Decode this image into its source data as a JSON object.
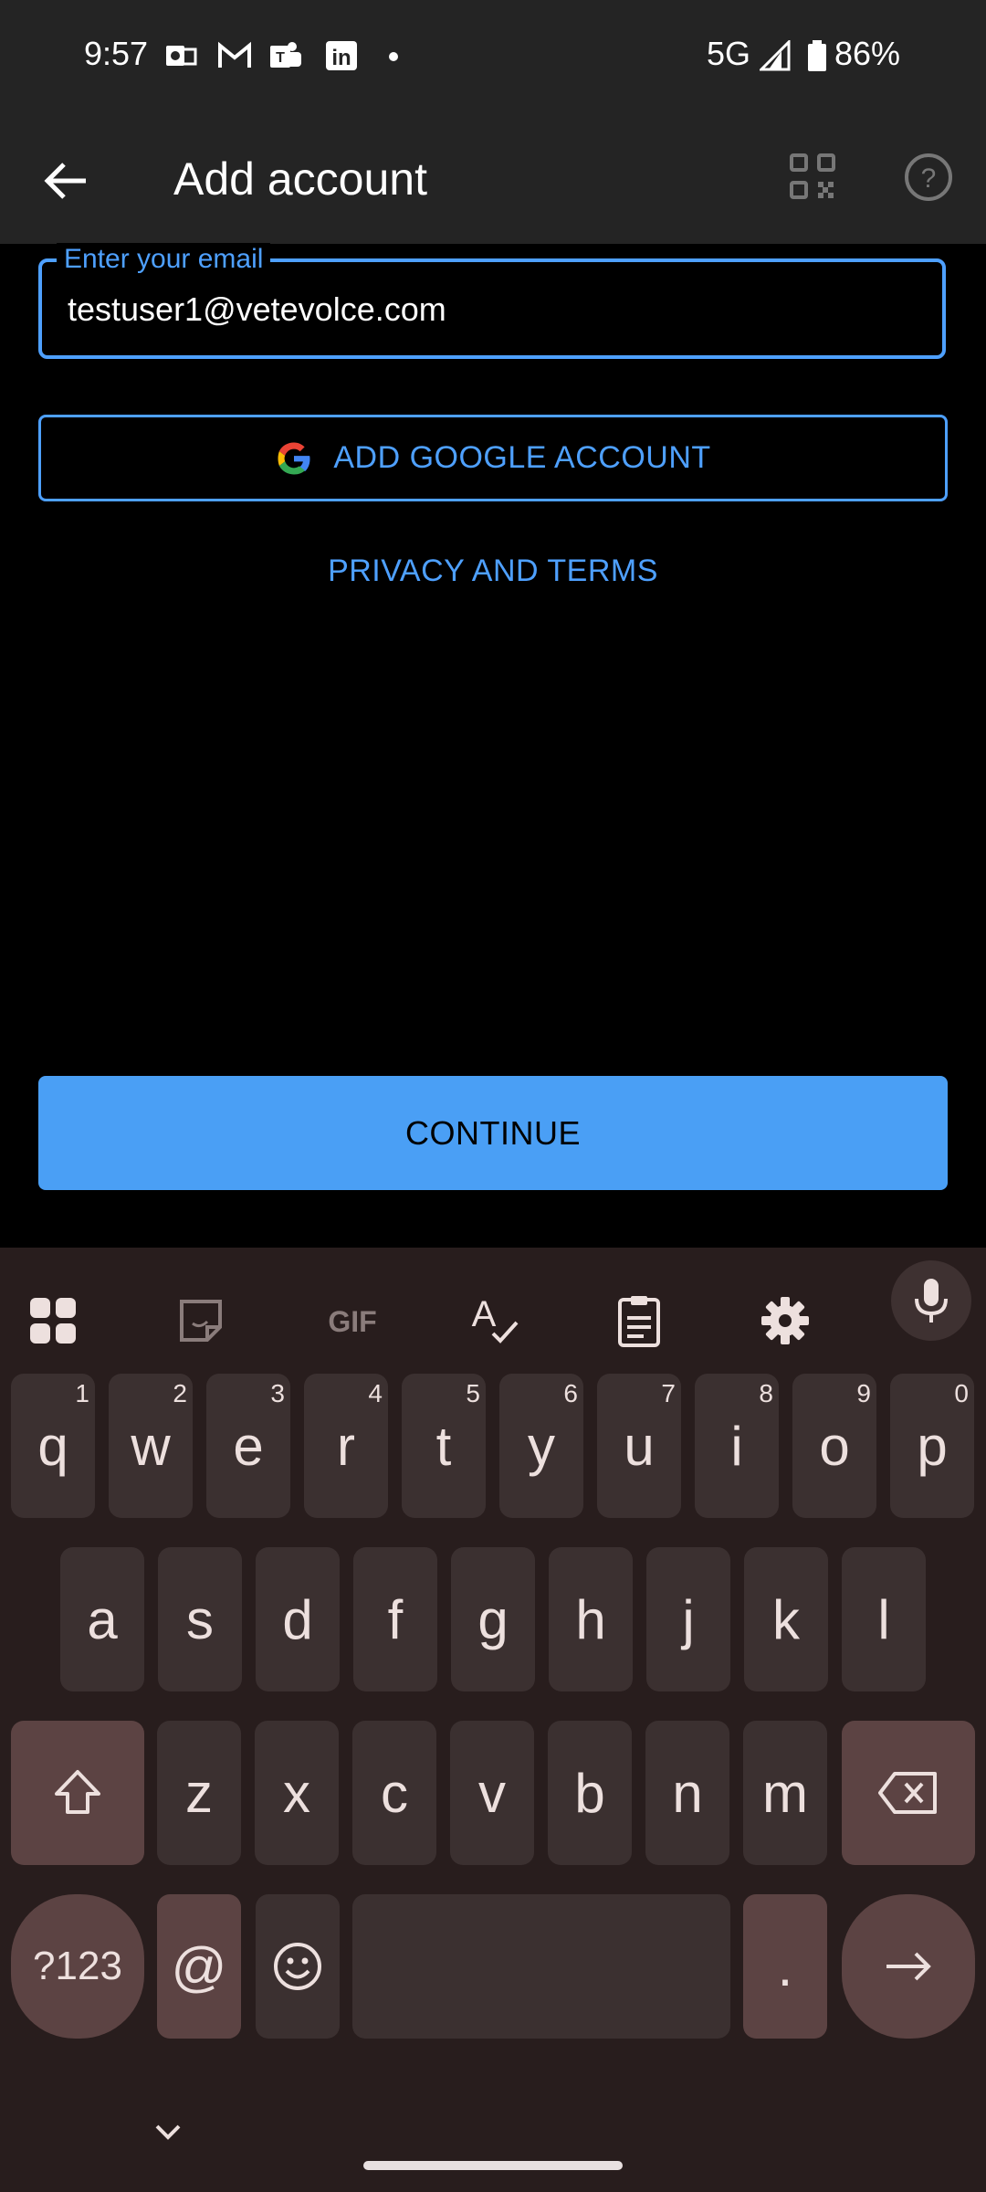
{
  "status_bar": {
    "time": "9:57",
    "network": "5G",
    "battery": "86%"
  },
  "app_bar": {
    "title": "Add account"
  },
  "email": {
    "label": "Enter your email",
    "value": "testuser1@vetevolce.com"
  },
  "buttons": {
    "google": "ADD GOOGLE ACCOUNT",
    "privacy": "PRIVACY AND TERMS",
    "continue": "CONTINUE"
  },
  "keyboard": {
    "row1": [
      {
        "k": "q",
        "n": "1"
      },
      {
        "k": "w",
        "n": "2"
      },
      {
        "k": "e",
        "n": "3"
      },
      {
        "k": "r",
        "n": "4"
      },
      {
        "k": "t",
        "n": "5"
      },
      {
        "k": "y",
        "n": "6"
      },
      {
        "k": "u",
        "n": "7"
      },
      {
        "k": "i",
        "n": "8"
      },
      {
        "k": "o",
        "n": "9"
      },
      {
        "k": "p",
        "n": "0"
      }
    ],
    "row2": [
      "a",
      "s",
      "d",
      "f",
      "g",
      "h",
      "j",
      "k",
      "l"
    ],
    "row3": [
      "z",
      "x",
      "c",
      "v",
      "b",
      "n",
      "m"
    ],
    "symbols": "?123",
    "at": "@",
    "period": "."
  },
  "colors": {
    "accent": "#4ea0ff",
    "continue_bg": "#4a9ff5",
    "keyboard_bg": "#281d1d"
  }
}
